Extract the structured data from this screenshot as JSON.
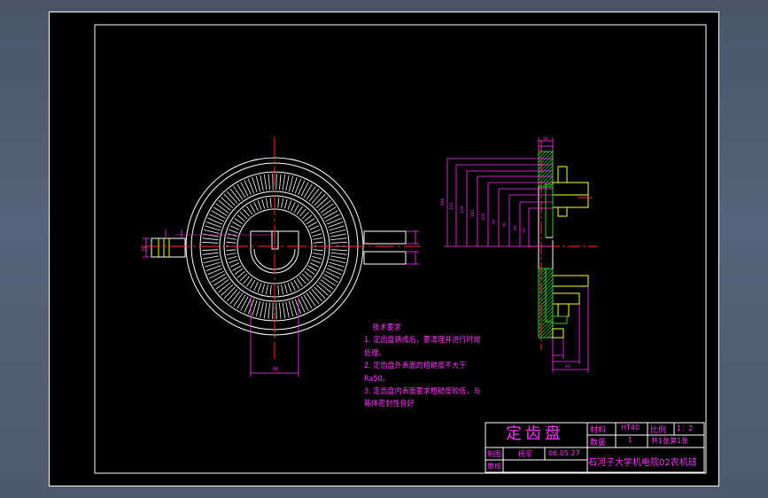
{
  "notes": {
    "title": "技术要求",
    "lines": [
      "1. 定齿盘铸成后，要清理并进行时效",
      "处理。",
      "2. 定齿盘外表面的粗糙度不大于",
      "Ra50。",
      "3. 定齿盘内表面要求粗糙度较低，与",
      "箱体密封性良好"
    ]
  },
  "title_block": {
    "part_name": "定齿盘",
    "material_label": "材料",
    "material": "HT40",
    "scale_label": "比例",
    "scale": "1：2",
    "quantity_label": "数量",
    "quantity": "1",
    "sheet": "共1张第1张",
    "drawn_label": "制图",
    "drawn_by": "杨军",
    "date": "06.05.27",
    "checked_label": "审核",
    "institution": "石河子大学机电院02农机班"
  },
  "colors": {
    "background": "#000000",
    "frame": "#ffffff",
    "centerline": "#ff2a2a",
    "dimension": "#ff33ff",
    "section": "#33cc33",
    "detail": "#ffff33"
  }
}
